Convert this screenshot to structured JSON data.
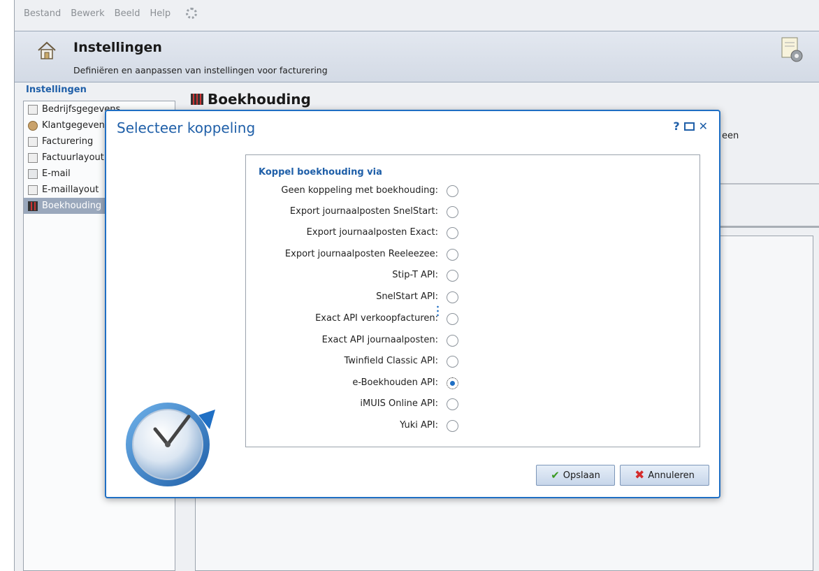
{
  "menu": [
    "Bestand",
    "Bewerk",
    "Beeld",
    "Help"
  ],
  "header": {
    "title": "Instellingen",
    "subtitle": "Definiëren en aanpassen van instellingen voor facturering"
  },
  "nav": {
    "heading": "Instellingen",
    "items": [
      "Bedrijfsgegevens",
      "Klantgegevens",
      "Facturering",
      "Factuurlayout",
      "E-mail",
      "E-maillayout",
      "Boekhouding"
    ]
  },
  "main": {
    "title": "Boekhouding",
    "peek_text": "een"
  },
  "dialog": {
    "title": "Selecteer koppeling",
    "help": "?",
    "close": "✕",
    "group_heading": "Koppel boekhouding via",
    "options": [
      "Geen koppeling met boekhouding:",
      "Export journaalposten SnelStart:",
      "Export journaalposten Exact:",
      "Export journaalposten Reeleezee:",
      "Stip-T API:",
      "SnelStart API:",
      "Exact API verkoopfacturen:",
      "Exact API journaalposten:",
      "Twinfield Classic API:",
      "e-Boekhouden API:",
      "iMUIS Online API:",
      "Yuki API:"
    ],
    "selected_option": "e-Boekhouden API:",
    "save_label": "Opslaan",
    "cancel_label": "Annuleren"
  },
  "colors": {
    "accent": "#1f6fc4",
    "nav_active": "#9aa8bc"
  }
}
